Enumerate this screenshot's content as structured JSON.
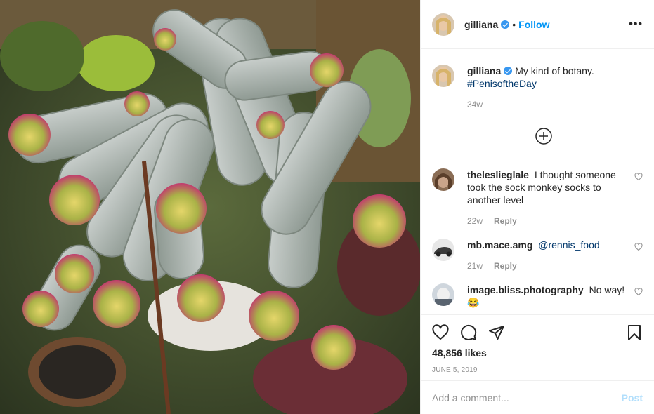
{
  "post": {
    "image_alt": "Cluster of fuzzy grey cacti with pink tips in a garden pot"
  },
  "author": {
    "username": "gilliana",
    "follow_label": "Follow",
    "dot": "•",
    "more": "•••"
  },
  "caption": {
    "username": "gilliana",
    "text": "My kind of botany.",
    "hashtag": "#PenisoftheDay",
    "time": "34w"
  },
  "comments": [
    {
      "username": "theleslieglale",
      "text": "I thought someone took the sock monkey socks to another level",
      "time": "22w",
      "reply": "Reply"
    },
    {
      "username": "mb.mace.amg",
      "mention": "@rennis_food",
      "time": "21w",
      "reply": "Reply"
    },
    {
      "username": "image.bliss.photography",
      "text": "No way!",
      "emoji": "😂"
    }
  ],
  "actions": {
    "likes": "48,856 likes",
    "date": "JUNE 5, 2019"
  },
  "comment_box": {
    "placeholder": "Add a comment...",
    "post_label": "Post"
  },
  "colors": {
    "link": "#00376b",
    "follow": "#0095f6",
    "verified": "#3897f0",
    "muted": "#8e8e8e",
    "post_disabled": "#b2dffc"
  }
}
